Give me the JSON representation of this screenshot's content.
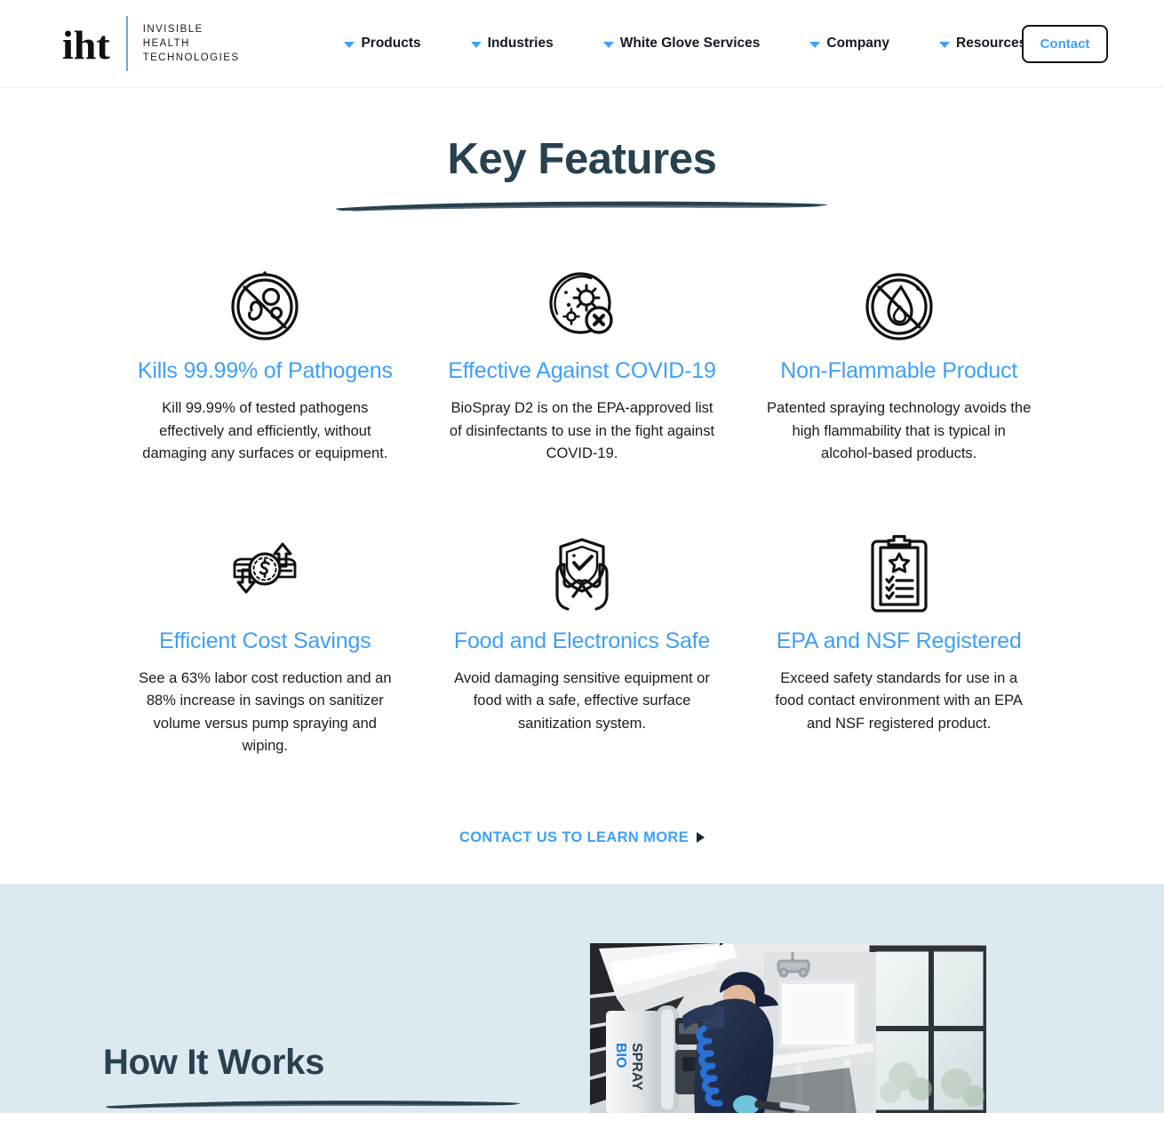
{
  "header": {
    "logo": {
      "mark": "iht",
      "line1": "INVISIBLE",
      "line2": "HEALTH",
      "line3": "TECHNOLOGIES"
    },
    "nav": [
      {
        "label": "Products",
        "icon": "chevron-down-icon",
        "has_dropdown": true
      },
      {
        "label": "Industries",
        "icon": "chevron-down-icon",
        "has_dropdown": true
      },
      {
        "label": "White Glove Services",
        "icon": "chevron-down-icon",
        "has_dropdown": true
      },
      {
        "label": "Company",
        "icon": "chevron-down-icon",
        "has_dropdown": true
      },
      {
        "label": "Resources",
        "icon": "chevron-down-icon",
        "has_dropdown": true
      }
    ],
    "contact_button": "Contact"
  },
  "features_section": {
    "title": "Key Features",
    "cards": [
      {
        "icon": "no-pathogens-icon",
        "title": "Kills 99.99% of Pathogens",
        "description": "Kill 99.99% of tested pathogens effectively and efficiently, without damaging any surfaces or equipment."
      },
      {
        "icon": "virus-blocked-icon",
        "title": "Effective Against COVID-19",
        "description": "BioSpray D2 is on the EPA-approved list of disinfectants to use in the fight against COVID-19."
      },
      {
        "icon": "no-flame-icon",
        "title": "Non-Flammable Product",
        "description": "Patented spraying technology avoids the high flammability that is typical in alcohol-based products."
      },
      {
        "icon": "cost-savings-icon",
        "title": "Efficient Cost Savings",
        "description": "See a 63% labor cost reduction and an 88% increase in savings on sanitizer volume versus pump spraying and wiping."
      },
      {
        "icon": "shield-hands-icon",
        "title": "Food and Electronics Safe",
        "description": "Avoid damaging sensitive equipment or food with a safe, effective surface sanitization system."
      },
      {
        "icon": "clipboard-checklist-icon",
        "title": "EPA and NSF Registered",
        "description": "Exceed safety standards for use in a food contact environment with an EPA and NSF registered product."
      }
    ],
    "cta_label": "CONTACT US TO LEARN MORE",
    "cta_arrow_icon": "triangle-right-icon"
  },
  "how_section": {
    "title": "How It Works",
    "photo_alt": "technician-spraying-with-biospray-backpack",
    "photo_brand_text": "BIO SPRAY"
  },
  "colors": {
    "accent_blue": "#3fa0f7",
    "heading_navy": "#27414f",
    "body_text": "#1c1c1c",
    "panel_blue": "#dce9ef",
    "logo_divider_blue": "#6fa8cc"
  }
}
